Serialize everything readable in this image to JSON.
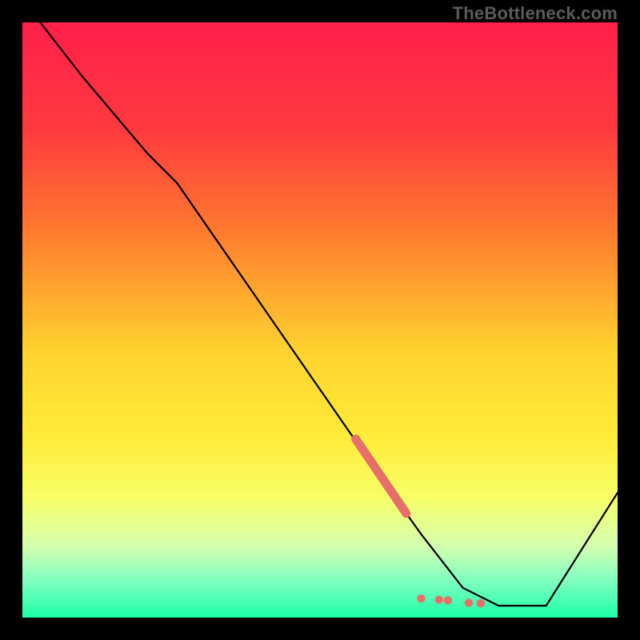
{
  "watermark": "TheBottleneck.com",
  "chart_data": {
    "type": "line",
    "title": "",
    "xlabel": "",
    "ylabel": "",
    "xlim": [
      0,
      100
    ],
    "ylim": [
      0,
      100
    ],
    "gradient_stops": [
      {
        "offset": 0,
        "color": "#ff1f4b"
      },
      {
        "offset": 18,
        "color": "#ff3a3f"
      },
      {
        "offset": 35,
        "color": "#ff7a2e"
      },
      {
        "offset": 55,
        "color": "#ffd22e"
      },
      {
        "offset": 70,
        "color": "#ffec3a"
      },
      {
        "offset": 80,
        "color": "#f7ff68"
      },
      {
        "offset": 88,
        "color": "#d4ffb0"
      },
      {
        "offset": 94,
        "color": "#7dffc0"
      },
      {
        "offset": 100,
        "color": "#1bffa6"
      }
    ],
    "series": [
      {
        "name": "bottleneck-curve",
        "x": [
          3,
          10,
          21,
          26,
          62,
          67,
          74,
          80,
          88,
          100
        ],
        "y": [
          100,
          91,
          78,
          73,
          21,
          14,
          5,
          2,
          2,
          21
        ]
      }
    ],
    "highlight_segment": {
      "x": [
        56,
        64.5
      ],
      "y": [
        30,
        17.5
      ]
    },
    "highlight_dots": [
      {
        "x": 67,
        "y": 3.2
      },
      {
        "x": 70,
        "y": 3.0
      },
      {
        "x": 71.5,
        "y": 2.9
      },
      {
        "x": 75,
        "y": 2.5
      },
      {
        "x": 77,
        "y": 2.4
      }
    ],
    "colors": {
      "curve": "#000000",
      "highlight": "#e76f6a"
    }
  }
}
